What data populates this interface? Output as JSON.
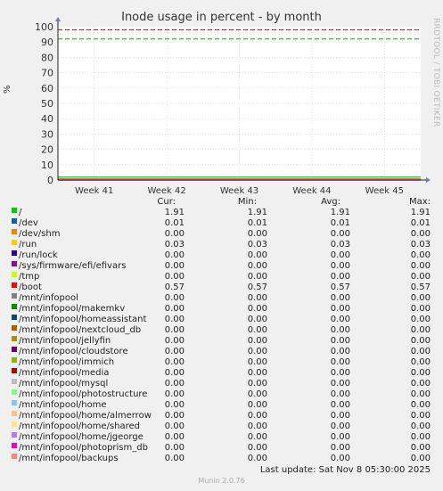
{
  "chart_data": {
    "type": "line",
    "title": "Inode usage in percent - by month",
    "ylabel": "%",
    "xlabel": "",
    "ylim": [
      0,
      100
    ],
    "yticks": [
      0,
      10,
      20,
      30,
      40,
      50,
      60,
      70,
      80,
      90,
      100
    ],
    "categories": [
      "Week 41",
      "Week 42",
      "Week 43",
      "Week 44",
      "Week 45"
    ],
    "grid": true,
    "thresholds": [
      {
        "value": 92,
        "color": "#00aa00",
        "style": "dashed"
      },
      {
        "value": 98,
        "color": "#ff0000",
        "style": "dashed"
      }
    ],
    "series": [
      {
        "name": "/",
        "color": "#00cc00",
        "cur": "1.91",
        "min": "1.91",
        "avg": "1.91",
        "max": "1.91",
        "value": 1.91
      },
      {
        "name": "/dev",
        "color": "#0066b3",
        "cur": "0.01",
        "min": "0.01",
        "avg": "0.01",
        "max": "0.01",
        "value": 0.01
      },
      {
        "name": "/dev/shm",
        "color": "#ff8000",
        "cur": "0.00",
        "min": "0.00",
        "avg": "0.00",
        "max": "0.00",
        "value": 0.0
      },
      {
        "name": "/run",
        "color": "#ffcc00",
        "cur": "0.03",
        "min": "0.03",
        "avg": "0.03",
        "max": "0.03",
        "value": 0.03
      },
      {
        "name": "/run/lock",
        "color": "#330099",
        "cur": "0.00",
        "min": "0.00",
        "avg": "0.00",
        "max": "0.00",
        "value": 0.0
      },
      {
        "name": "/sys/firmware/efi/efivars",
        "color": "#990099",
        "cur": "0.00",
        "min": "0.00",
        "avg": "0.00",
        "max": "0.00",
        "value": 0.0
      },
      {
        "name": "/tmp",
        "color": "#ccff00",
        "cur": "0.00",
        "min": "0.00",
        "avg": "0.00",
        "max": "0.00",
        "value": 0.0
      },
      {
        "name": "/boot",
        "color": "#ff0000",
        "cur": "0.57",
        "min": "0.57",
        "avg": "0.57",
        "max": "0.57",
        "value": 0.57
      },
      {
        "name": "/mnt/infopool",
        "color": "#808080",
        "cur": "0.00",
        "min": "0.00",
        "avg": "0.00",
        "max": "0.00",
        "value": 0.0
      },
      {
        "name": "/mnt/infopool/makemkv",
        "color": "#008f00",
        "cur": "0.00",
        "min": "0.00",
        "avg": "0.00",
        "max": "0.00",
        "value": 0.0
      },
      {
        "name": "/mnt/infopool/homeassistant",
        "color": "#00487d",
        "cur": "0.00",
        "min": "0.00",
        "avg": "0.00",
        "max": "0.00",
        "value": 0.0
      },
      {
        "name": "/mnt/infopool/nextcloud_db",
        "color": "#b35a00",
        "cur": "0.00",
        "min": "0.00",
        "avg": "0.00",
        "max": "0.00",
        "value": 0.0
      },
      {
        "name": "/mnt/infopool/jellyfin",
        "color": "#b38f00",
        "cur": "0.00",
        "min": "0.00",
        "avg": "0.00",
        "max": "0.00",
        "value": 0.0
      },
      {
        "name": "/mnt/infopool/cloudstore",
        "color": "#6b006b",
        "cur": "0.00",
        "min": "0.00",
        "avg": "0.00",
        "max": "0.00",
        "value": 0.0
      },
      {
        "name": "/mnt/infopool/immich",
        "color": "#8fb300",
        "cur": "0.00",
        "min": "0.00",
        "avg": "0.00",
        "max": "0.00",
        "value": 0.0
      },
      {
        "name": "/mnt/infopool/media",
        "color": "#b30000",
        "cur": "0.00",
        "min": "0.00",
        "avg": "0.00",
        "max": "0.00",
        "value": 0.0
      },
      {
        "name": "/mnt/infopool/mysql",
        "color": "#bebebe",
        "cur": "0.00",
        "min": "0.00",
        "avg": "0.00",
        "max": "0.00",
        "value": 0.0
      },
      {
        "name": "/mnt/infopool/photostructure",
        "color": "#80ff80",
        "cur": "0.00",
        "min": "0.00",
        "avg": "0.00",
        "max": "0.00",
        "value": 0.0
      },
      {
        "name": "/mnt/infopool/home",
        "color": "#80c9ff",
        "cur": "0.00",
        "min": "0.00",
        "avg": "0.00",
        "max": "0.00",
        "value": 0.0
      },
      {
        "name": "/mnt/infopool/home/almerrow",
        "color": "#ffc080",
        "cur": "0.00",
        "min": "0.00",
        "avg": "0.00",
        "max": "0.00",
        "value": 0.0
      },
      {
        "name": "/mnt/infopool/home/shared",
        "color": "#ffe680",
        "cur": "0.00",
        "min": "0.00",
        "avg": "0.00",
        "max": "0.00",
        "value": 0.0
      },
      {
        "name": "/mnt/infopool/home/jgeorge",
        "color": "#aa80ff",
        "cur": "0.00",
        "min": "0.00",
        "avg": "0.00",
        "max": "0.00",
        "value": 0.0
      },
      {
        "name": "/mnt/infopool/photoprism_db",
        "color": "#ee00cc",
        "cur": "0.00",
        "min": "0.00",
        "avg": "0.00",
        "max": "0.00",
        "value": 0.0
      },
      {
        "name": "/mnt/infopool/backups",
        "color": "#ff8080",
        "cur": "0.00",
        "min": "0.00",
        "avg": "0.00",
        "max": "0.00",
        "value": 0.0
      }
    ]
  },
  "legend_headers": {
    "cur": "Cur:",
    "min": "Min:",
    "avg": "Avg:",
    "max": "Max:"
  },
  "side_label": "RRDTOOL / TOBI OETIKER",
  "last_update": "Last update: Sat Nov  8 05:30:00 2025",
  "munin_version": "Munin 2.0.76"
}
